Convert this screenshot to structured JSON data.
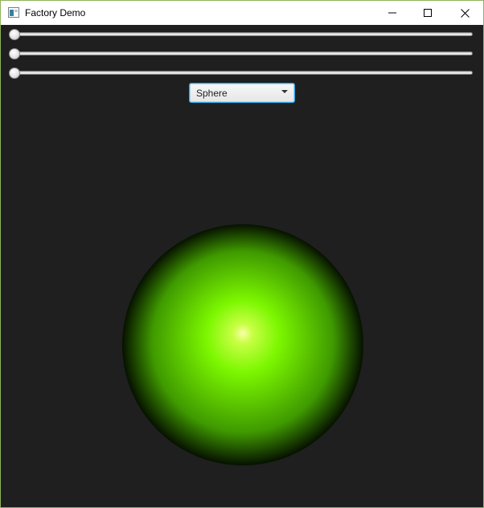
{
  "window": {
    "title": "Factory Demo",
    "icon": "app-window-icon",
    "controls": {
      "minimize_icon": "minimize-icon",
      "maximize_icon": "maximize-icon",
      "close_icon": "close-icon"
    }
  },
  "sliders": [
    {
      "name": "slider-1",
      "value": 0
    },
    {
      "name": "slider-2",
      "value": 0
    },
    {
      "name": "slider-3",
      "value": 0
    }
  ],
  "shape_selector": {
    "selected": "Sphere"
  },
  "viewport": {
    "shape": "sphere",
    "colors": {
      "highlight": "#fdffa8",
      "base": "#7cf700",
      "shadow": "#061100",
      "background": "#1f1f1f"
    }
  }
}
